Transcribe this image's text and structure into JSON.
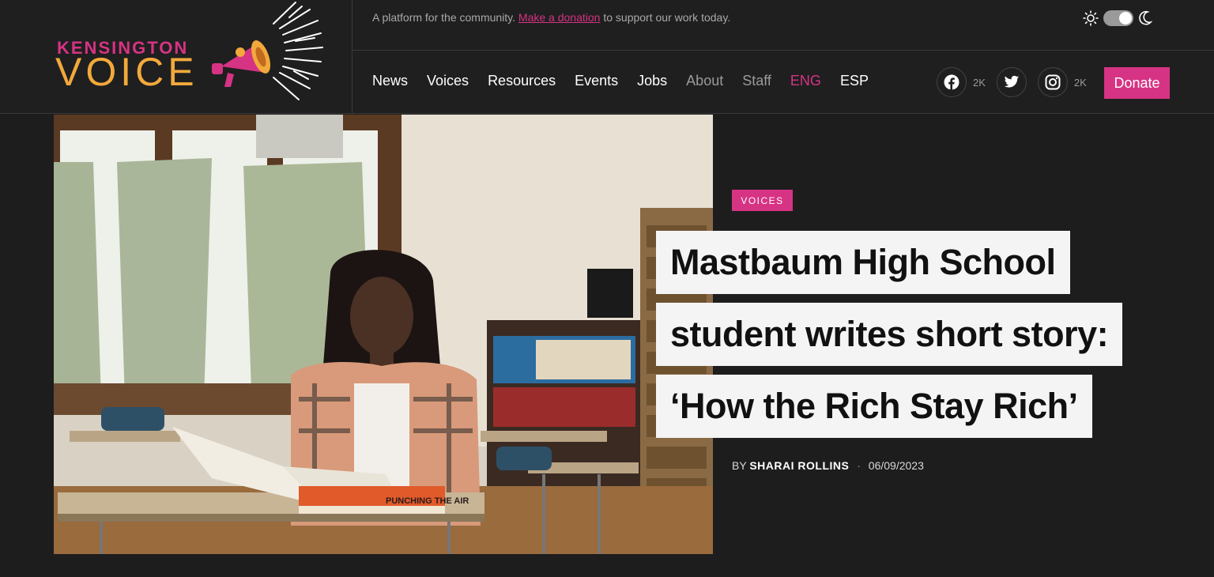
{
  "logo": {
    "top": "KENSINGTON",
    "bottom": "VOICE"
  },
  "topbar": {
    "tagline_before": "A platform for the community. ",
    "donation_link": "Make a donation",
    "tagline_after": " to support our work today."
  },
  "nav": {
    "items": [
      "News",
      "Voices",
      "Resources",
      "Events",
      "Jobs",
      "About",
      "Staff",
      "ENG",
      "ESP"
    ]
  },
  "social": {
    "facebook_count": "2K",
    "instagram_count": "2K"
  },
  "donate_label": "Donate",
  "article": {
    "category": "VOICES",
    "headline_lines": [
      "Mastbaum High School",
      "student writes short story:",
      "‘How the Rich Stay Rich’"
    ],
    "by_label": "BY",
    "author": "SHARAI ROLLINS",
    "separator": "·",
    "date": "06/09/2023",
    "book_title": "PUNCHING THE AIR"
  },
  "colors": {
    "accent": "#d63384",
    "logo_orange": "#f2a93b",
    "background": "#1d1d1d"
  }
}
